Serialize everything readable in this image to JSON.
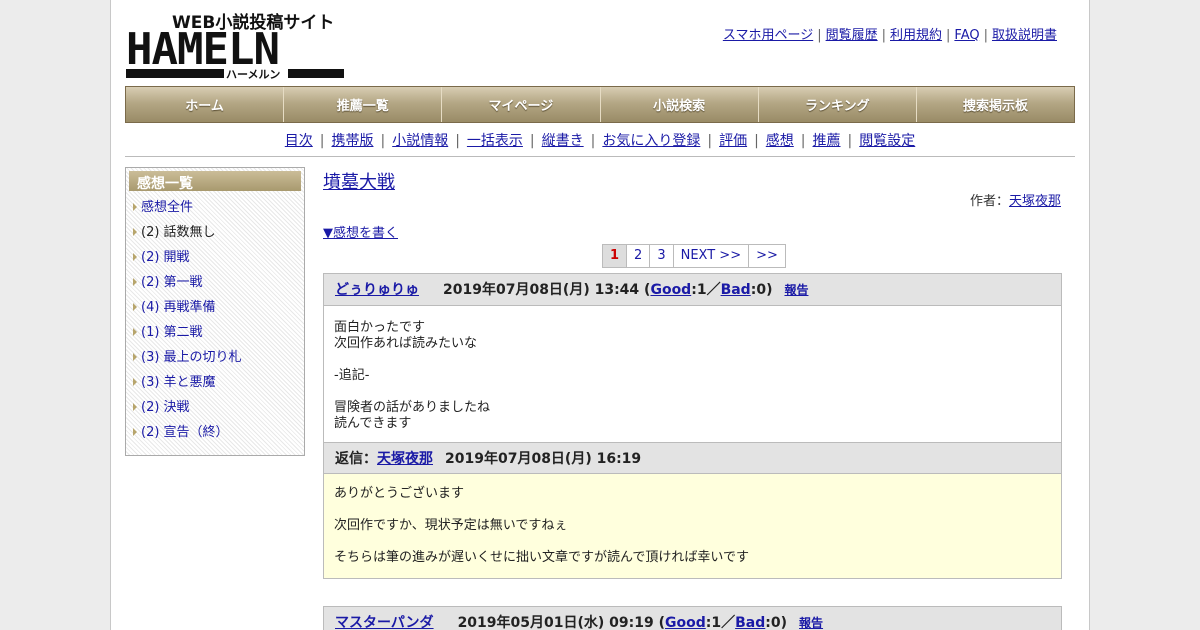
{
  "header": {
    "logo_tagline": "WEB小説投稿サイト",
    "logo_main": "HAMELN",
    "logo_sub": "ハーメルン",
    "links": [
      "スマホ用ページ",
      "閲覧履歴",
      "利用規約",
      "FAQ",
      "取扱説明書"
    ]
  },
  "nav": [
    "ホーム",
    "推薦一覧",
    "マイページ",
    "小説検索",
    "ランキング",
    "捜索掲示板"
  ],
  "subnav": [
    "目次",
    "携帯版",
    "小説情報",
    "一括表示",
    "縦書き",
    "お気に入り登録",
    "評価",
    "感想",
    "推薦",
    "閲覧設定"
  ],
  "sidebar": {
    "title": "感想一覧",
    "items": [
      {
        "label": "感想全件",
        "link": true
      },
      {
        "label": "(2) 話数無し",
        "link": false
      },
      {
        "label": "(2) 開戦",
        "link": true
      },
      {
        "label": "(2) 第一戦",
        "link": true
      },
      {
        "label": "(4) 再戦準備",
        "link": true
      },
      {
        "label": "(1) 第二戦",
        "link": true
      },
      {
        "label": "(3) 最上の切り札",
        "link": true
      },
      {
        "label": "(3) 羊と悪魔",
        "link": true
      },
      {
        "label": "(2) 決戦",
        "link": true
      },
      {
        "label": "(2) 宣告（終）",
        "link": true
      }
    ]
  },
  "novel": {
    "title": "墳墓大戦",
    "author_label": "作者：",
    "author": "天塚夜那",
    "write_link": "▼感想を書く"
  },
  "pager": {
    "current": "1",
    "pages": [
      "2",
      "3"
    ],
    "next": "NEXT >>",
    "last": ">>"
  },
  "comments": [
    {
      "user": "どぅりゅりゅ",
      "date": "2019年07月08日(月) 13:44",
      "good_label": "Good",
      "good_count": "1",
      "bad_label": "Bad",
      "bad_count": "0",
      "report": "報告",
      "lines": [
        "面白かったです",
        "次回作あれば読みたいな",
        "",
        "-追記-",
        "",
        "冒険者の話がありましたね",
        "読んできます"
      ],
      "reply": {
        "label": "返信：",
        "user": "天塚夜那",
        "date": "2019年07月08日(月) 16:19",
        "lines": [
          "ありがとうございます",
          "",
          "次回作ですか、現状予定は無いですねぇ",
          "",
          "そちらは筆の進みが遅いくせに拙い文章ですが読んで頂ければ幸いです"
        ]
      }
    },
    {
      "user": "マスターパンダ",
      "date": "2019年05月01日(水) 09:19",
      "good_label": "Good",
      "good_count": "1",
      "bad_label": "Bad",
      "bad_count": "0",
      "report": "報告"
    }
  ]
}
